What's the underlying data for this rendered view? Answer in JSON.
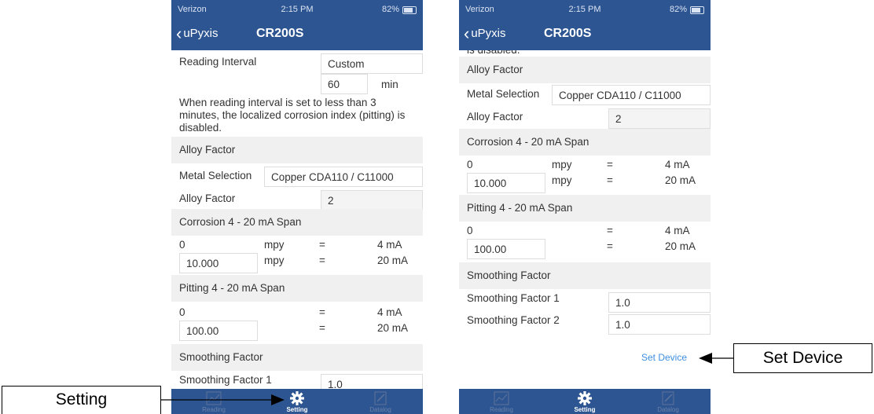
{
  "status": {
    "carrier": "Verizon",
    "time": "2:15 PM",
    "battery": "82%"
  },
  "nav": {
    "back": "uPyxis",
    "title": "CR200S"
  },
  "reading": {
    "label": "Reading Interval",
    "mode": "Custom",
    "value": "60",
    "unit": "min",
    "note": "When reading interval is set to less than 3 minutes, the localized corrosion index (pitting) is disabled.",
    "note_tail": "is disabled."
  },
  "alloy": {
    "header": "Alloy Factor",
    "metal_label": "Metal Selection",
    "metal_value": "Copper CDA110 / C11000",
    "factor_label": "Alloy Factor",
    "factor_value": "2"
  },
  "corrosion": {
    "header": "Corrosion 4 - 20 mA Span",
    "low": "0",
    "high": "10.000",
    "unit": "mpy",
    "eq": "=",
    "ma_low": "4 mA",
    "ma_high": "20 mA"
  },
  "pitting": {
    "header": "Pitting 4 - 20 mA Span",
    "low": "0",
    "high": "100.00",
    "eq": "=",
    "ma_low": "4 mA",
    "ma_high": "20 mA"
  },
  "smoothing": {
    "header": "Smoothing Factor",
    "f1_label": "Smoothing Factor 1",
    "f1_value": "1.0",
    "f2_label": "Smoothing Factor 2",
    "f2_value": "1.0"
  },
  "set_device": "Set Device",
  "tabs": [
    "Reading",
    "Setting",
    "Datalog"
  ],
  "callouts": {
    "setting": "Setting",
    "set_device": "Set Device"
  },
  "colors": {
    "bar": "#2d5592",
    "link": "#3d8ee0",
    "section": "#f0f0f0"
  }
}
